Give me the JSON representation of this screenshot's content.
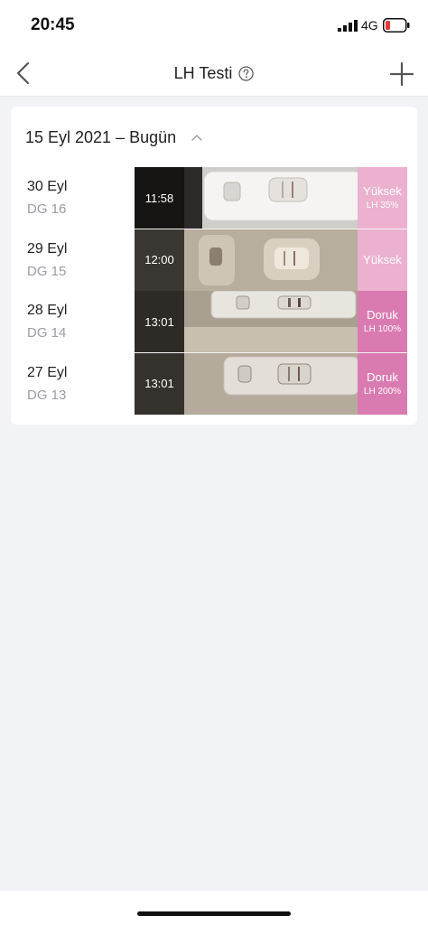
{
  "status_bar": {
    "time": "20:45",
    "network": "4G",
    "signal_icon": "signal-bars-icon",
    "battery_icon": "battery-low-icon"
  },
  "nav": {
    "title": "LH Testi",
    "back_icon": "chevron-left-icon",
    "help_icon": "question-circle-icon",
    "add_icon": "plus-icon"
  },
  "card": {
    "title": "15 Eyl 2021 – Bugün",
    "collapse_icon": "chevron-up-icon",
    "rows": [
      {
        "date": "30 Eyl",
        "cycle_day": "DG 16",
        "time": "11:58",
        "result": "Yüksek",
        "lh": "LH 35%"
      },
      {
        "date": "29 Eyl",
        "cycle_day": "DG 15",
        "time": "12:00",
        "result": "Yüksek",
        "lh": ""
      },
      {
        "date": "28 Eyl",
        "cycle_day": "DG 14",
        "time": "13:01",
        "result": "Doruk",
        "lh": "LH 100%"
      },
      {
        "date": "27 Eyl",
        "cycle_day": "DG 13",
        "time": "13:01",
        "result": "Doruk",
        "lh": "LH 200%"
      }
    ]
  },
  "colors": {
    "high": "#ebb1cf",
    "peak": "#d97bb0",
    "background": "#f2f3f7"
  }
}
